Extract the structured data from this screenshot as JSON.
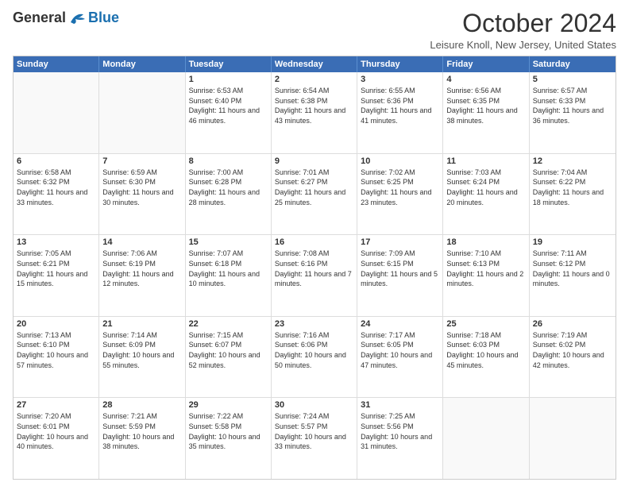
{
  "logo": {
    "general": "General",
    "blue": "Blue"
  },
  "title": "October 2024",
  "location": "Leisure Knoll, New Jersey, United States",
  "days": [
    "Sunday",
    "Monday",
    "Tuesday",
    "Wednesday",
    "Thursday",
    "Friday",
    "Saturday"
  ],
  "weeks": [
    [
      {
        "day": "",
        "empty": true
      },
      {
        "day": "",
        "empty": true
      },
      {
        "day": "1",
        "sunrise": "6:53 AM",
        "sunset": "6:40 PM",
        "daylight": "11 hours and 46 minutes."
      },
      {
        "day": "2",
        "sunrise": "6:54 AM",
        "sunset": "6:38 PM",
        "daylight": "11 hours and 43 minutes."
      },
      {
        "day": "3",
        "sunrise": "6:55 AM",
        "sunset": "6:36 PM",
        "daylight": "11 hours and 41 minutes."
      },
      {
        "day": "4",
        "sunrise": "6:56 AM",
        "sunset": "6:35 PM",
        "daylight": "11 hours and 38 minutes."
      },
      {
        "day": "5",
        "sunrise": "6:57 AM",
        "sunset": "6:33 PM",
        "daylight": "11 hours and 36 minutes."
      }
    ],
    [
      {
        "day": "6",
        "sunrise": "6:58 AM",
        "sunset": "6:32 PM",
        "daylight": "11 hours and 33 minutes."
      },
      {
        "day": "7",
        "sunrise": "6:59 AM",
        "sunset": "6:30 PM",
        "daylight": "11 hours and 30 minutes."
      },
      {
        "day": "8",
        "sunrise": "7:00 AM",
        "sunset": "6:28 PM",
        "daylight": "11 hours and 28 minutes."
      },
      {
        "day": "9",
        "sunrise": "7:01 AM",
        "sunset": "6:27 PM",
        "daylight": "11 hours and 25 minutes."
      },
      {
        "day": "10",
        "sunrise": "7:02 AM",
        "sunset": "6:25 PM",
        "daylight": "11 hours and 23 minutes."
      },
      {
        "day": "11",
        "sunrise": "7:03 AM",
        "sunset": "6:24 PM",
        "daylight": "11 hours and 20 minutes."
      },
      {
        "day": "12",
        "sunrise": "7:04 AM",
        "sunset": "6:22 PM",
        "daylight": "11 hours and 18 minutes."
      }
    ],
    [
      {
        "day": "13",
        "sunrise": "7:05 AM",
        "sunset": "6:21 PM",
        "daylight": "11 hours and 15 minutes."
      },
      {
        "day": "14",
        "sunrise": "7:06 AM",
        "sunset": "6:19 PM",
        "daylight": "11 hours and 12 minutes."
      },
      {
        "day": "15",
        "sunrise": "7:07 AM",
        "sunset": "6:18 PM",
        "daylight": "11 hours and 10 minutes."
      },
      {
        "day": "16",
        "sunrise": "7:08 AM",
        "sunset": "6:16 PM",
        "daylight": "11 hours and 7 minutes."
      },
      {
        "day": "17",
        "sunrise": "7:09 AM",
        "sunset": "6:15 PM",
        "daylight": "11 hours and 5 minutes."
      },
      {
        "day": "18",
        "sunrise": "7:10 AM",
        "sunset": "6:13 PM",
        "daylight": "11 hours and 2 minutes."
      },
      {
        "day": "19",
        "sunrise": "7:11 AM",
        "sunset": "6:12 PM",
        "daylight": "11 hours and 0 minutes."
      }
    ],
    [
      {
        "day": "20",
        "sunrise": "7:13 AM",
        "sunset": "6:10 PM",
        "daylight": "10 hours and 57 minutes."
      },
      {
        "day": "21",
        "sunrise": "7:14 AM",
        "sunset": "6:09 PM",
        "daylight": "10 hours and 55 minutes."
      },
      {
        "day": "22",
        "sunrise": "7:15 AM",
        "sunset": "6:07 PM",
        "daylight": "10 hours and 52 minutes."
      },
      {
        "day": "23",
        "sunrise": "7:16 AM",
        "sunset": "6:06 PM",
        "daylight": "10 hours and 50 minutes."
      },
      {
        "day": "24",
        "sunrise": "7:17 AM",
        "sunset": "6:05 PM",
        "daylight": "10 hours and 47 minutes."
      },
      {
        "day": "25",
        "sunrise": "7:18 AM",
        "sunset": "6:03 PM",
        "daylight": "10 hours and 45 minutes."
      },
      {
        "day": "26",
        "sunrise": "7:19 AM",
        "sunset": "6:02 PM",
        "daylight": "10 hours and 42 minutes."
      }
    ],
    [
      {
        "day": "27",
        "sunrise": "7:20 AM",
        "sunset": "6:01 PM",
        "daylight": "10 hours and 40 minutes."
      },
      {
        "day": "28",
        "sunrise": "7:21 AM",
        "sunset": "5:59 PM",
        "daylight": "10 hours and 38 minutes."
      },
      {
        "day": "29",
        "sunrise": "7:22 AM",
        "sunset": "5:58 PM",
        "daylight": "10 hours and 35 minutes."
      },
      {
        "day": "30",
        "sunrise": "7:24 AM",
        "sunset": "5:57 PM",
        "daylight": "10 hours and 33 minutes."
      },
      {
        "day": "31",
        "sunrise": "7:25 AM",
        "sunset": "5:56 PM",
        "daylight": "10 hours and 31 minutes."
      },
      {
        "day": "",
        "empty": true
      },
      {
        "day": "",
        "empty": true
      }
    ]
  ]
}
